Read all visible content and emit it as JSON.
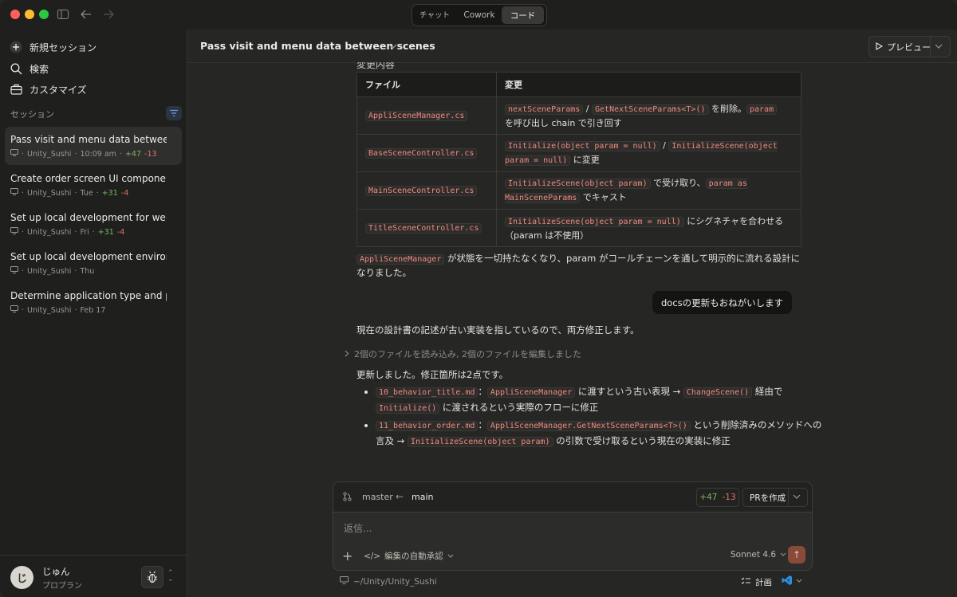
{
  "window": {
    "tabs": [
      {
        "label": "チャット",
        "active": false
      },
      {
        "label": "Cowork",
        "active": false
      },
      {
        "label": "コード",
        "active": true
      }
    ]
  },
  "sidebar": {
    "new_session": "新規セッション",
    "search": "検索",
    "customize": "カスタマイズ",
    "section_label": "セッション",
    "sessions": [
      {
        "title": "Pass visit and menu data between scenes",
        "project": "Unity_Sushi",
        "time": "10:09 am",
        "added": "+47",
        "removed": "-13",
        "active": true
      },
      {
        "title": "Create order screen UI component setup",
        "project": "Unity_Sushi",
        "time": "Tue",
        "added": "+31",
        "removed": "-4",
        "active": false
      },
      {
        "title": "Set up local development for web order",
        "project": "Unity_Sushi",
        "time": "Fri",
        "added": "+31",
        "removed": "-4",
        "active": false
      },
      {
        "title": "Set up local development environment",
        "project": "Unity_Sushi",
        "time": "Thu",
        "added": "",
        "removed": "",
        "active": false
      },
      {
        "title": "Determine application type and purpose",
        "project": "Unity_Sushi",
        "time": "Feb 17",
        "added": "",
        "removed": "",
        "active": false
      }
    ],
    "user": {
      "initial": "じ",
      "name": "じゅん",
      "plan": "プロプラン"
    }
  },
  "header": {
    "title": "Pass visit and menu data between scenes",
    "preview_label": "プレビュー"
  },
  "content": {
    "clipped_heading": "変更内容",
    "table": {
      "headers": [
        "ファイル",
        "変更"
      ],
      "rows": [
        {
          "file": "AppliSceneManager.cs",
          "c1": "nextSceneParams",
          "t1": " / ",
          "c2": "GetNextSceneParams<T>()",
          "t2": " を削除。",
          "c3": "param",
          "t3": "を呼び出し chain で引き回す"
        },
        {
          "file": "BaseSceneController.cs",
          "c1": "Initialize(object param = null)",
          "t1": " / ",
          "c2": "InitializeScene(object param = null)",
          "t2": " に変更",
          "c3": "",
          "t3": ""
        },
        {
          "file": "MainSceneController.cs",
          "c1": "InitializeScene(object param)",
          "t1": " で受け取り、",
          "c2": "param as MainSceneParams",
          "t2": " でキャスト",
          "c3": "",
          "t3": ""
        },
        {
          "file": "TitleSceneController.cs",
          "c1": "InitializeScene(object param = null)",
          "t1": " にシグネチャを合わせる（param は不使用）",
          "c2": "",
          "t2": "",
          "c3": "",
          "t3": ""
        }
      ]
    },
    "summary_code": "AppliSceneManager",
    "summary_text": " が状態を一切持たなくなり、param がコールチェーンを通して明示的に流れる設計になりました。",
    "user_message": "docsの更新もおねがいします",
    "response_intro": "現在の設計書の記述が古い実装を指しているので、両方修正します。",
    "tool_summary": "2個のファイルを読み込み, 2個のファイルを編集しました",
    "response_done": "更新しました。修正箇所は2点です。",
    "changes": [
      {
        "c1": "10_behavior_title.md",
        "t1": "：",
        "c2": "AppliSceneManager",
        "t2": " に渡すという古い表現 → ",
        "c3": "ChangeScene()",
        "t3": " 経由で ",
        "c4": "Initialize()",
        "t4": " に渡されるという実際のフローに修正"
      },
      {
        "c1": "11_behavior_order.md",
        "t1": "：",
        "c2": "AppliSceneManager.GetNextSceneParams<T>()",
        "t2": " という削除済みのメソッドへの言及 → ",
        "c3": "InitializeScene(object param)",
        "t3": " の引数で受け取るという現在の実装に修正",
        "c4": "",
        "t4": ""
      }
    ]
  },
  "composer": {
    "branch_from": "master",
    "branch_to": "main",
    "added": "+47",
    "removed": "-13",
    "pr_label": "PRを作成",
    "placeholder": "返信...",
    "auto_approve": "編集の自動承認",
    "model": "Sonnet 4.6"
  },
  "footer": {
    "path": "~/Unity/Unity_Sushi",
    "plan_label": "計画"
  },
  "colors": {
    "accent_added": "#7bb661",
    "accent_removed": "#e27268",
    "code_text": "#ec8b7f",
    "send_button": "#8a4a3a"
  }
}
